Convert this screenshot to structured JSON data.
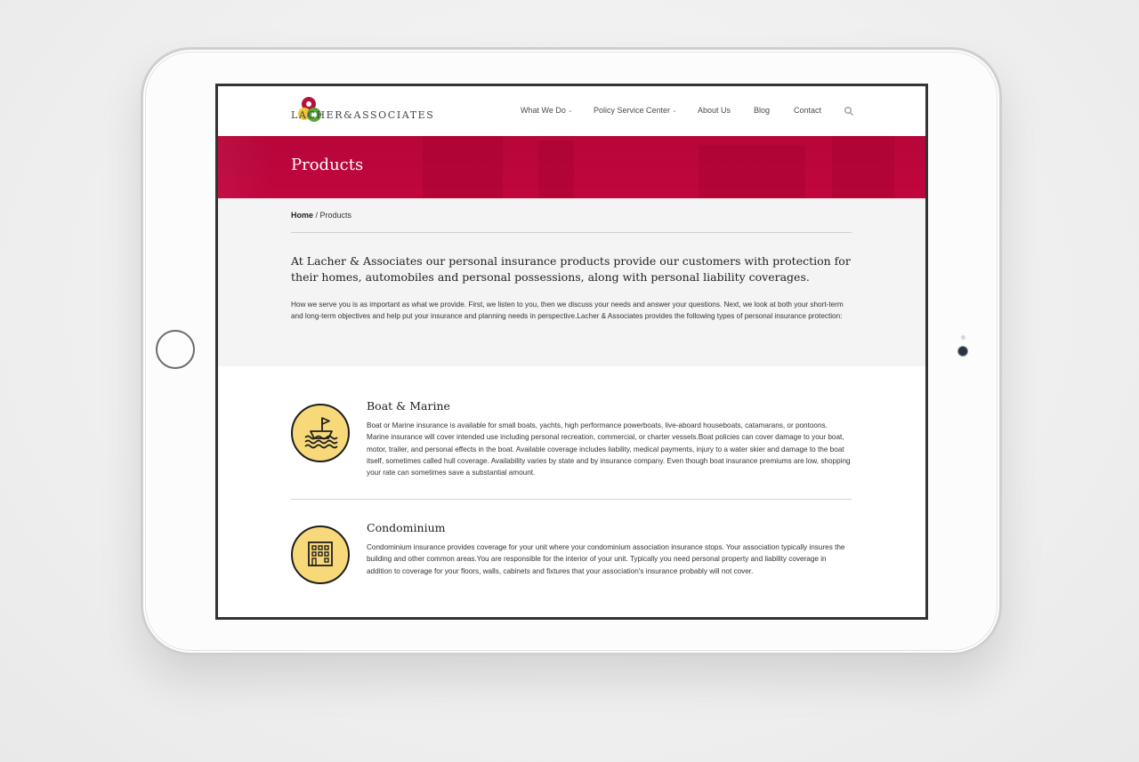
{
  "logo": {
    "text": "LACHER&ASSOCIATES"
  },
  "nav": {
    "items": [
      {
        "label": "What We Do",
        "dropdown": true
      },
      {
        "label": "Policy Service Center",
        "dropdown": true
      },
      {
        "label": "About Us",
        "dropdown": false
      },
      {
        "label": "Blog",
        "dropdown": false
      },
      {
        "label": "Contact",
        "dropdown": false
      }
    ],
    "search_icon": "search-icon"
  },
  "hero": {
    "title": "Products"
  },
  "breadcrumb": {
    "home": "Home",
    "separator": " / ",
    "current": "Products"
  },
  "intro": {
    "lead": "At Lacher & Associates our personal insurance products provide our customers with protection for their homes, automobiles and personal possessions, along with personal liability coverages.",
    "body": "How we serve you is as important as what we provide. First, we listen to you, then we discuss your needs and answer your questions. Next, we look at both your short-term and long-term objectives and help put your insurance and planning needs in perspective.Lacher & Associates provides the following types of personal insurance protection:"
  },
  "products": [
    {
      "title": "Boat & Marine",
      "icon": "boat-icon",
      "description": "Boat or Marine insurance is available for small boats, yachts, high performance powerboats, live-aboard houseboats, catamarans, or pontoons. Marine insurance will cover intended use including personal recreation, commercial, or charter vessels.Boat policies can cover damage to your boat, motor, trailer, and personal effects in the boat. Available coverage includes liability, medical payments, injury to a water skier and damage to the boat itself, sometimes called hull coverage. Availability varies by state and by insurance company. Even though boat insurance premiums are low, shopping your rate can sometimes save a substantial amount."
    },
    {
      "title": "Condominium",
      "icon": "building-icon",
      "description": "Condominium insurance provides coverage for your unit where your condominium association insurance stops. Your association typically insures the building and other common areas.You are responsible for the interior of your unit. Typically you need personal property and liability coverage in addition to coverage for your floors, walls, cabinets and fixtures that your association's insurance probably will not cover."
    }
  ],
  "colors": {
    "brand_red": "#c0063d",
    "icon_yellow": "#f8d97a",
    "logo_red": "#b5123a",
    "logo_green": "#5aa53a",
    "logo_yellow": "#f2c53d"
  }
}
